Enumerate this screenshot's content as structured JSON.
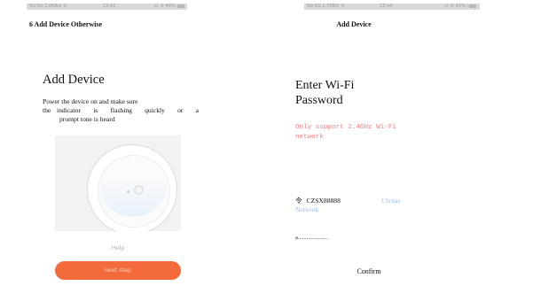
{
  "left": {
    "status_bar": {
      "left_text": "5G·5G 1.0KB/s 令",
      "time": "13:41",
      "right_text": "☷ 令 45% ▭"
    },
    "section_heading": "6 Add Device Otherwise",
    "title": "Add Device",
    "instructions": {
      "line1": "Power the device on and make sure",
      "line2_prefix": "the",
      "line2": "indicator is flashing quickly or a",
      "line3": "prompt tone is heard"
    },
    "help_label": "Help",
    "next_button_label": "next step",
    "colors": {
      "accent": "#f36b3a"
    }
  },
  "right": {
    "status_bar": {
      "left_text": "5G·5G 2.7KB/s 令",
      "time": "13:44",
      "right_text": "☷ 令 45% ▭"
    },
    "screen_title": "Add Device",
    "title_line1": "Enter Wi-Fi",
    "title_line2": "Password",
    "warning_line1": "Only support 2.4GHz Wi-Fi",
    "warning_line2": "network",
    "wifi": {
      "icon": "wifi-icon",
      "symbol": "令",
      "ssid": "CZSX88888",
      "change_label": "Chrnas",
      "change_label_line2": "Network"
    },
    "password_value": "a.....................",
    "confirm_label": "Confirm",
    "colors": {
      "warning": "#f08080",
      "link": "#9bbde6"
    }
  }
}
